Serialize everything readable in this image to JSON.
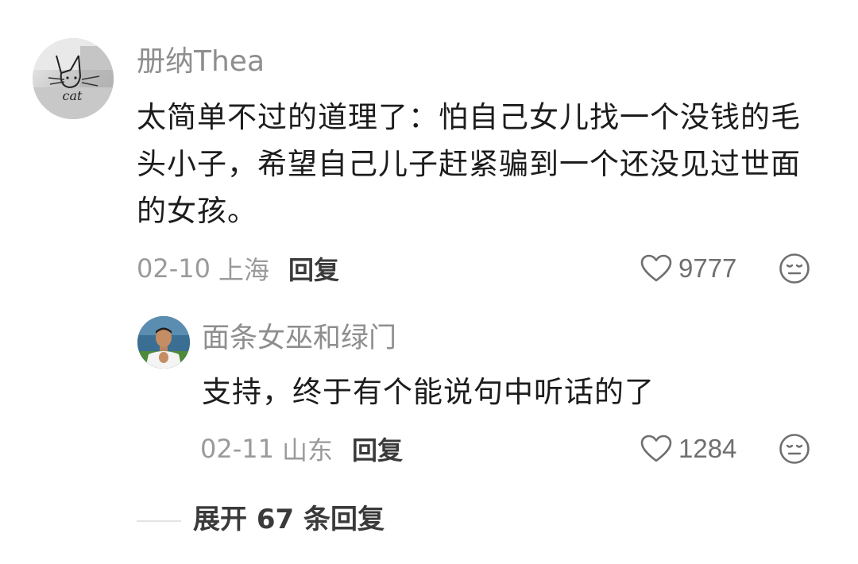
{
  "comment": {
    "author": "册纳Thea",
    "content_lines": [
      "太简单不过的道理了：怕自己女儿找一个没钱的毛",
      "头小子，希望自己儿子赶紧骗到一个还没见过世面",
      "的女孩。"
    ],
    "date": "02-10",
    "location": "上海",
    "reply_label": "回复",
    "likes": "9777",
    "avatar_text": "cat",
    "avatar_icon": "cat-sketch-avatar",
    "like_icon": "heart-outline-icon",
    "dislike_icon": "sad-face-icon"
  },
  "reply": {
    "author": "面条女巫和绿门",
    "content": "支持，终于有个能说句中听话的了",
    "date": "02-11",
    "location": "山东",
    "reply_label": "回复",
    "likes": "1284",
    "avatar_icon": "football-player-avatar"
  },
  "expand": {
    "label": "展开 67 条回复"
  },
  "colors": {
    "username": "#8e8e8e",
    "meta": "#9a9a9a",
    "text": "#1c1c1c",
    "reply_button": "#3a3a3a",
    "divider": "#e3e3e3"
  }
}
